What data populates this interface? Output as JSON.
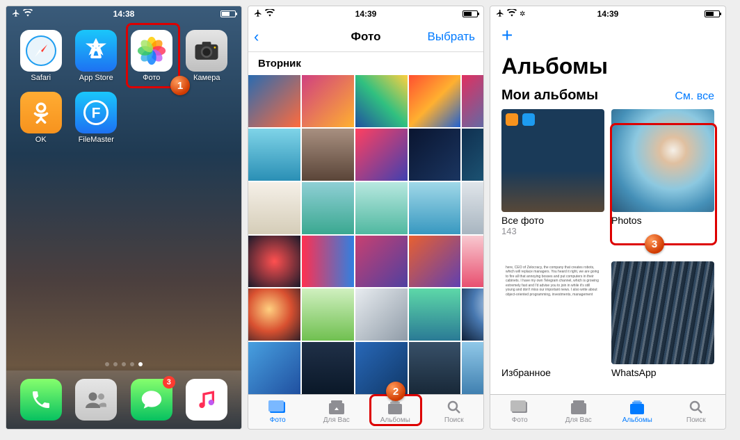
{
  "status": {
    "time": "14:38",
    "time2": "14:39",
    "time3": "14:39"
  },
  "annotations": {
    "n1": "1",
    "n2": "2",
    "n3": "3"
  },
  "home": {
    "apps": [
      {
        "name": "safari",
        "label": "Safari"
      },
      {
        "name": "appstore",
        "label": "App Store"
      },
      {
        "name": "photos",
        "label": "Фото"
      },
      {
        "name": "camera",
        "label": "Камера"
      },
      {
        "name": "ok",
        "label": "OK"
      },
      {
        "name": "filemaster",
        "label": "FileMaster"
      }
    ],
    "dock": {
      "messages_badge": "3"
    }
  },
  "photos": {
    "title": "Фото",
    "select": "Выбрать",
    "section": "Вторник",
    "tabs": {
      "photos": "Фото",
      "foryou": "Для Вас",
      "albums": "Альбомы",
      "search": "Поиск"
    }
  },
  "albums": {
    "title": "Альбомы",
    "my_albums": "Мои альбомы",
    "see_all": "См. все",
    "items": [
      {
        "name": "Все фото",
        "count": "143"
      },
      {
        "name": "Photos",
        "count": ""
      },
      {
        "name": "Избранное",
        "count": ""
      },
      {
        "name": "WhatsApp",
        "count": ""
      }
    ],
    "tabs": {
      "photos": "Фото",
      "foryou": "Для Вас",
      "albums": "Альбомы",
      "search": "Поиск"
    }
  }
}
